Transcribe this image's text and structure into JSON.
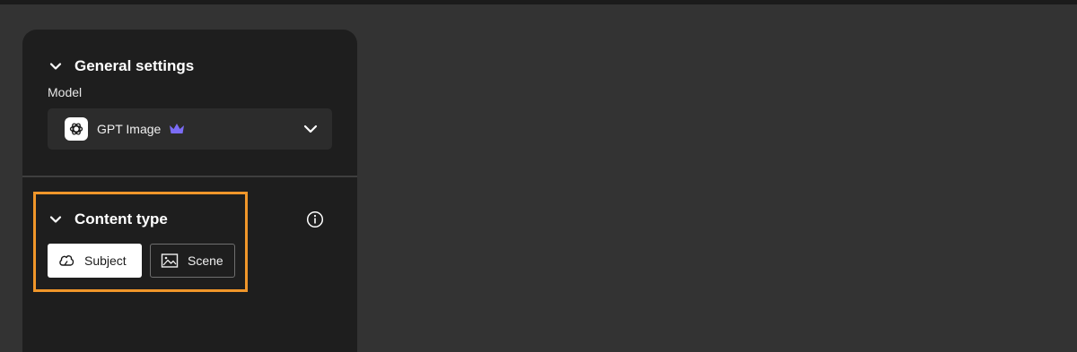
{
  "general_settings": {
    "title": "General settings",
    "model_label": "Model",
    "model_value": "GPT Image",
    "premium_icon": "crown-icon",
    "premium_color": "#7b6cf6"
  },
  "content_type": {
    "title": "Content type",
    "info_icon": "info-icon",
    "options": [
      {
        "label": "Subject",
        "icon": "subject-icon",
        "selected": true
      },
      {
        "label": "Scene",
        "icon": "scene-icon",
        "selected": false
      }
    ]
  },
  "colors": {
    "highlight": "#f0962a",
    "panel": "#1e1e1e",
    "background": "#333333"
  }
}
